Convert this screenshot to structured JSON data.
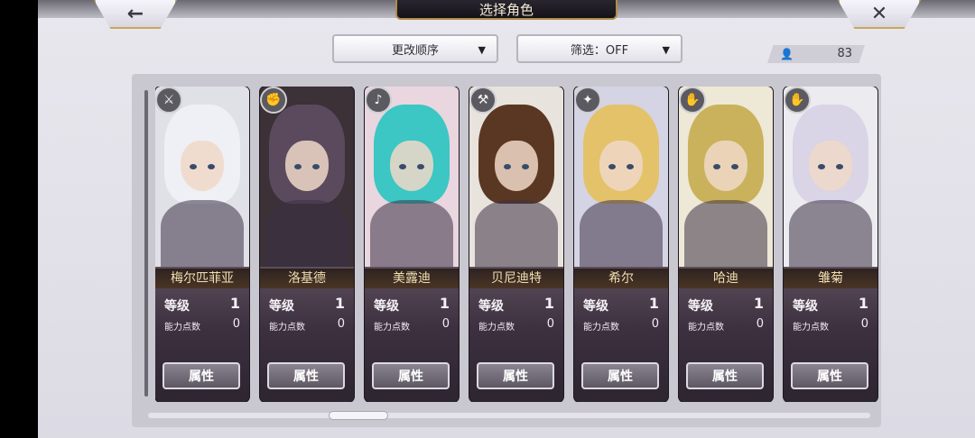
{
  "header": {
    "title": "选择角色",
    "back_icon": "←",
    "close_icon": "✕"
  },
  "toolbar": {
    "order_label": "更改顺序",
    "filter_label": "筛选：OFF",
    "dropdown_arrow": "▼",
    "character_count": "83",
    "person_icon": "👤"
  },
  "cards": [
    {
      "name": "梅尔匹菲亚",
      "level_label": "等级",
      "level": "1",
      "ap_label": "能力点数",
      "ap": "0",
      "button": "属性",
      "badge_icon": "sword-icon",
      "badge_glyph": "⚔",
      "art_bg": "#dfe1e6",
      "hair": "#eef0f5"
    },
    {
      "name": "洛基德",
      "level_label": "等级",
      "level": "1",
      "ap_label": "能力点数",
      "ap": "0",
      "button": "属性",
      "badge_icon": "fist-icon",
      "badge_glyph": "✊",
      "art_bg": "#3b3136",
      "hair": "#5b4a5d"
    },
    {
      "name": "美露迪",
      "level_label": "等级",
      "level": "1",
      "ap_label": "能力点数",
      "ap": "0",
      "button": "属性",
      "badge_icon": "music-icon",
      "badge_glyph": "♪",
      "art_bg": "#e9d6df",
      "hair": "#3cc6c4"
    },
    {
      "name": "贝尼迪特",
      "level_label": "等级",
      "level": "1",
      "ap_label": "能力点数",
      "ap": "0",
      "button": "属性",
      "badge_icon": "axe-icon",
      "badge_glyph": "⚒",
      "art_bg": "#e8e3dc",
      "hair": "#5a3722"
    },
    {
      "name": "希尔",
      "level_label": "等级",
      "level": "1",
      "ap_label": "能力点数",
      "ap": "0",
      "button": "属性",
      "badge_icon": "wand-icon",
      "badge_glyph": "✦",
      "art_bg": "#d5d4e4",
      "hair": "#e3c26a"
    },
    {
      "name": "哈迪",
      "level_label": "等级",
      "level": "1",
      "ap_label": "能力点数",
      "ap": "0",
      "button": "属性",
      "badge_icon": "gauntlet-icon",
      "badge_glyph": "✋",
      "art_bg": "#eee8d6",
      "hair": "#c9b25b"
    },
    {
      "name": "雏菊",
      "level_label": "等级",
      "level": "1",
      "ap_label": "能力点数",
      "ap": "0",
      "button": "属性",
      "badge_icon": "gauntlet-icon",
      "badge_glyph": "✋",
      "art_bg": "#ecebf0",
      "hair": "#d9d4e6"
    }
  ]
}
